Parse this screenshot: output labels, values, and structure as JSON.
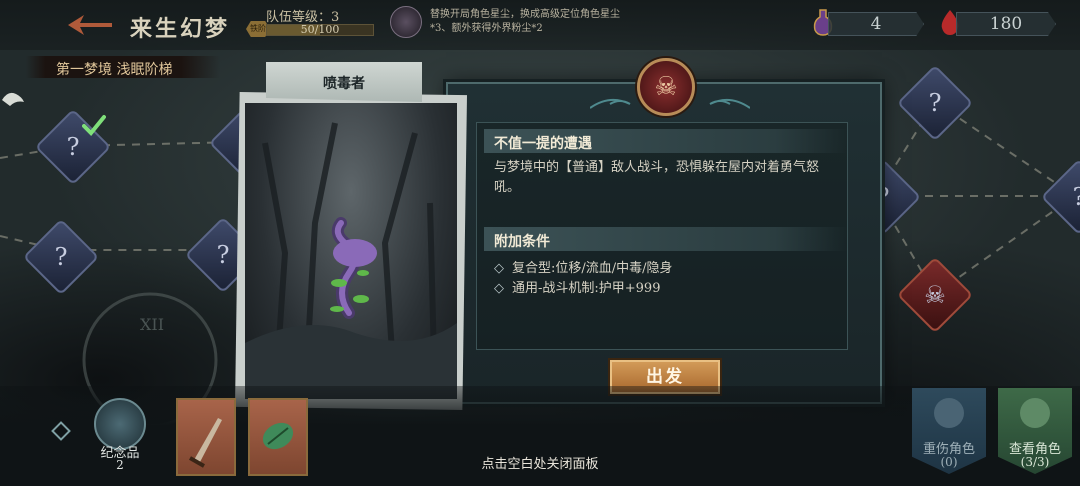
{
  "header": {
    "title": "来生幻梦",
    "team_level_label": "队伍等级：3",
    "team_exp": "50/100",
    "rank_badge": "铁阶",
    "relic_description": "替换开局角色星尘，换成高级定位角色星尘*3、额外获得外界粉尘*2"
  },
  "resources": {
    "potion": "4",
    "blood": "180"
  },
  "stage": {
    "banner": "第一梦境 浅眠阶梯"
  },
  "enemy_card": {
    "name": "喷毒者"
  },
  "panel": {
    "section1_title": "不值一提的遭遇",
    "section1_body": "与梦境中的【普通】敌人战斗，恐惧躲在屋内对着勇气怒吼。",
    "section2_title": "附加条件",
    "conditions": [
      "复合型:位移/流血/中毒/隐身",
      "通用-战斗机制:护甲+999"
    ],
    "depart_label": "出发"
  },
  "bottom": {
    "souvenir_label": "纪念品",
    "souvenir_count": "2",
    "close_hint": "点击空白处关闭面板",
    "injured_label": "重伤角色",
    "injured_count": "(0)",
    "view_label": "查看角色",
    "view_count": "(3/3)"
  },
  "map_nodes": [
    {
      "glyph": "?",
      "style": "dark"
    },
    {
      "glyph": "?",
      "style": "dark"
    },
    {
      "glyph": "?",
      "style": "dark"
    },
    {
      "glyph": "?",
      "style": "dark"
    },
    {
      "glyph": "?",
      "style": "dark"
    },
    {
      "glyph": "?",
      "style": "dark"
    },
    {
      "glyph": "?",
      "style": "dark"
    },
    {
      "glyph": "☠",
      "style": "red"
    },
    {
      "glyph": "☠",
      "style": "red"
    }
  ],
  "colors": {
    "accent_gold": "#d29a58",
    "panel_teal": "#203034",
    "node_red": "#7a2a2a",
    "node_blue": "#3f4a6a"
  }
}
